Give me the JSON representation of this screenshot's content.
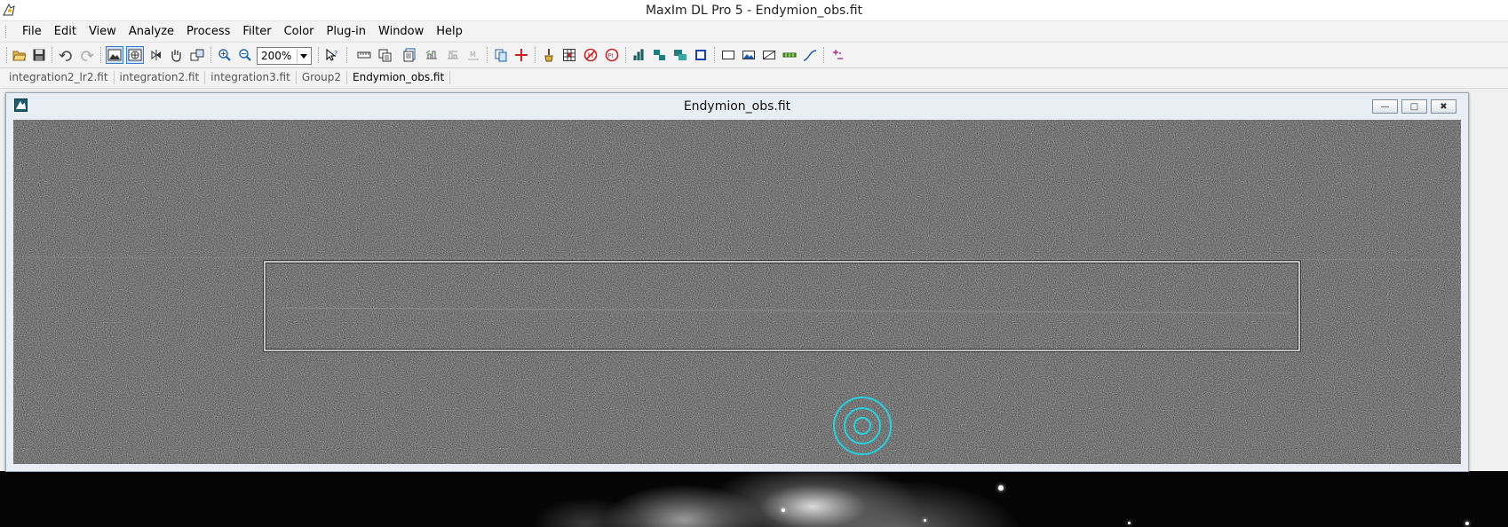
{
  "app": {
    "title": "MaxIm DL Pro 5 - Endymion_obs.fit"
  },
  "menu": {
    "items": [
      "File",
      "Edit",
      "View",
      "Analyze",
      "Process",
      "Filter",
      "Color",
      "Plug-in",
      "Window",
      "Help"
    ]
  },
  "toolbar": {
    "zoom_value": "200%",
    "icons": [
      "open-folder-icon",
      "save-icon",
      "undo-icon",
      "redo-icon",
      "screen-stretch-icon",
      "auto-stretch-icon",
      "rotate-icon",
      "hand-pan-icon",
      "link-icon",
      "zoom-in-icon",
      "zoom-out-icon",
      "help-pointer-icon",
      "ruler-icon",
      "clipboard-icon",
      "document-stack-icon",
      "calibrate-icon",
      "align-icon",
      "measure-icon",
      "copy-icon",
      "crosshair-icon",
      "paintbrush-icon",
      "grid-icon",
      "no-entry-icon",
      "pi-icon",
      "histogram-icon",
      "stack-icon",
      "layers-icon",
      "square-outline-icon",
      "rectangle-icon",
      "image-icon",
      "curve-icon",
      "stretch-bar-icon",
      "line-curve-icon",
      "plus-minus-icon"
    ]
  },
  "tabs": {
    "items": [
      "integration2_lr2.fit",
      "integration2.fit",
      "integration3.fit",
      "Group2",
      "Endymion_obs.fit"
    ],
    "active_index": 4
  },
  "image_window": {
    "title": "Endymion_obs.fit",
    "minimize_label": "—",
    "maximize_label": "□",
    "close_label": "✖"
  },
  "colors": {
    "aperture_rings": "#22d3e0",
    "selection_border": "#ffffff",
    "active_tab_accent": "#3a7bd5"
  }
}
